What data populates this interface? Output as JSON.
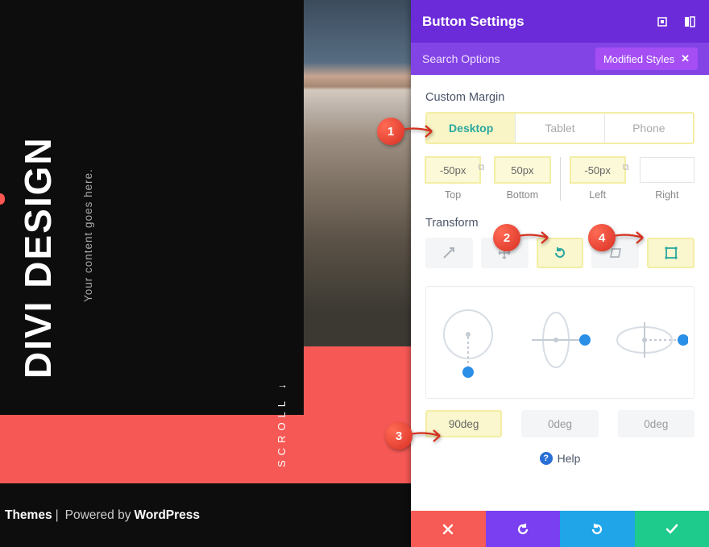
{
  "left": {
    "headline": "DIVI DESIGN",
    "subhead": "Your content goes here.",
    "scroll": "SCROLL ↓"
  },
  "footer": {
    "themes": "Themes",
    "sep": " | ",
    "powered": "Powered by ",
    "wp": "WordPress"
  },
  "panel": {
    "title": "Button Settings",
    "search_placeholder": "Search Options",
    "modified_label": "Modified Styles",
    "sections": {
      "margin_title": "Custom Margin",
      "transform_title": "Transform"
    },
    "device_tabs": [
      "Desktop",
      "Tablet",
      "Phone"
    ],
    "device_active": 0,
    "margins": {
      "top": {
        "label": "Top",
        "value": "-50px",
        "highlight": true
      },
      "bottom": {
        "label": "Bottom",
        "value": "50px",
        "highlight": true
      },
      "left": {
        "label": "Left",
        "value": "-50px",
        "highlight": true
      },
      "right": {
        "label": "Right",
        "value": "",
        "highlight": false
      }
    },
    "transform_tabs": [
      {
        "icon": "scale-icon",
        "highlight": false
      },
      {
        "icon": "move-icon",
        "highlight": false
      },
      {
        "icon": "rotate-icon",
        "highlight": true
      },
      {
        "icon": "skew-icon",
        "highlight": false
      },
      {
        "icon": "origin-icon",
        "highlight": true
      }
    ],
    "degrees": [
      {
        "value": "90deg",
        "highlight": true
      },
      {
        "value": "0deg",
        "highlight": false
      },
      {
        "value": "0deg",
        "highlight": false
      }
    ],
    "help": "Help"
  },
  "annotations": {
    "a1": "1",
    "a2": "2",
    "a3": "3",
    "a4": "4"
  },
  "colors": {
    "purple": "#6c2bd9",
    "purple2": "#8344e6",
    "coral": "#f65955",
    "teal": "#2aa89f",
    "highlight": "#faf6cd"
  }
}
